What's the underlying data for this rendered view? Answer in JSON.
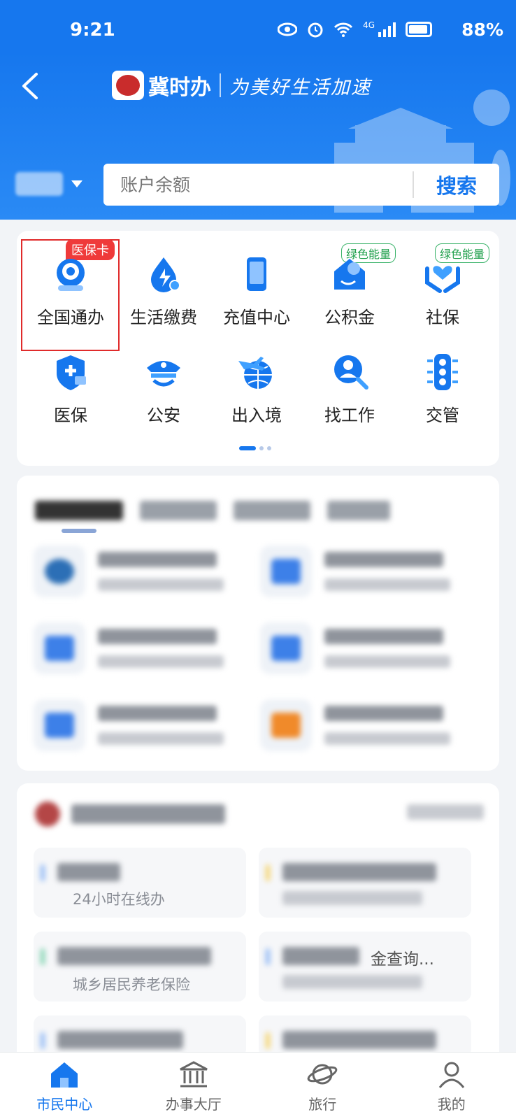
{
  "status_bar": {
    "time": "9:21",
    "battery": "88%",
    "network": "4G"
  },
  "header": {
    "brand": "冀时办",
    "slogan": "为美好生活加速",
    "search": {
      "placeholder": "账户余额",
      "button": "搜索"
    }
  },
  "quick_grid": {
    "items": [
      {
        "label": "全国通办",
        "icon": "global-service-icon",
        "badge": "医保卡"
      },
      {
        "label": "生活缴费",
        "icon": "utility-payment-icon"
      },
      {
        "label": "充值中心",
        "icon": "phone-topup-icon"
      },
      {
        "label": "公积金",
        "icon": "housing-fund-icon",
        "badge": "绿色能量"
      },
      {
        "label": "社保",
        "icon": "social-security-icon",
        "badge": "绿色能量"
      },
      {
        "label": "医保",
        "icon": "medical-insurance-icon"
      },
      {
        "label": "公安",
        "icon": "police-icon"
      },
      {
        "label": "出入境",
        "icon": "travel-globe-icon"
      },
      {
        "label": "找工作",
        "icon": "job-search-icon"
      },
      {
        "label": "交管",
        "icon": "traffic-light-icon"
      }
    ]
  },
  "zone": {
    "tile1_sub": "24小时在线办",
    "tile3_sub": "城乡居民养老保险",
    "tile4_sub": "金查询..."
  },
  "bottom_nav": {
    "items": [
      {
        "label": "市民中心",
        "icon": "home-icon",
        "active": true
      },
      {
        "label": "办事大厅",
        "icon": "hall-icon"
      },
      {
        "label": "旅行",
        "icon": "planet-icon"
      },
      {
        "label": "我的",
        "icon": "user-icon"
      }
    ]
  },
  "colors": {
    "primary": "#1677ee",
    "badge_red": "#ef3a3a",
    "badge_green": "#1f9f4b"
  }
}
